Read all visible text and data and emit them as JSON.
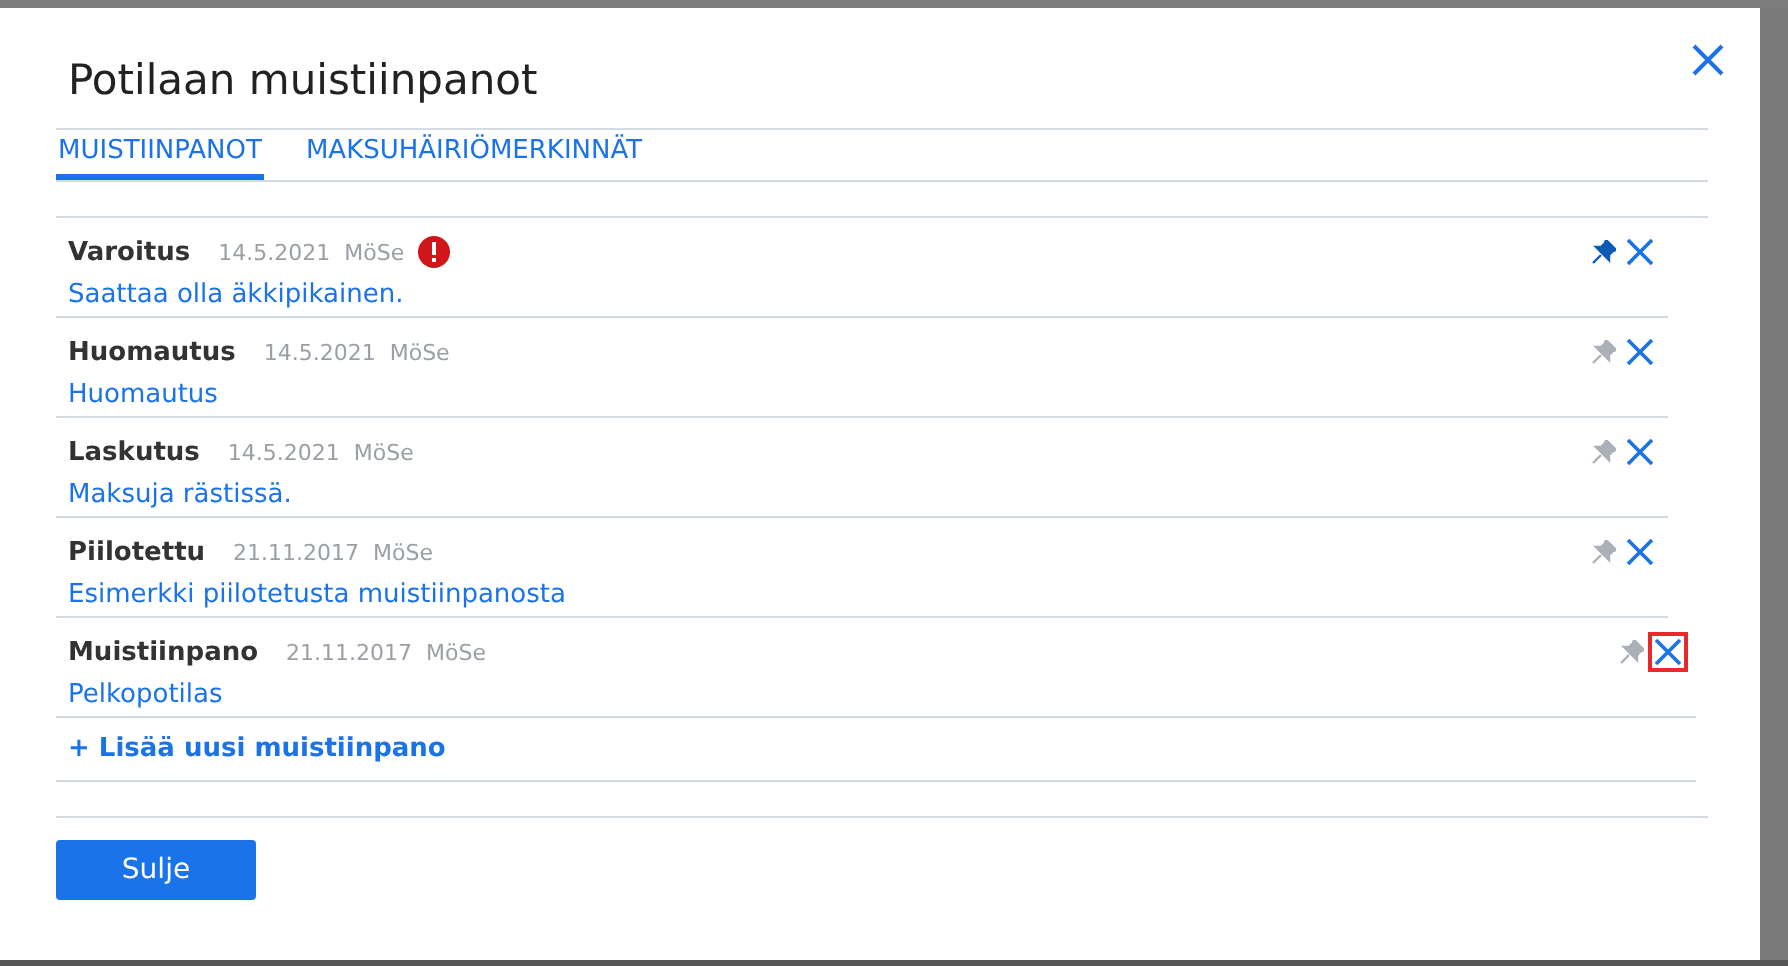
{
  "dialog": {
    "title": "Potilaan muistiinpanot"
  },
  "tabs": [
    {
      "label": "MUISTIINPANOT",
      "selected": true
    },
    {
      "label": "MAKSUHÄIRIÖMERKINNÄT",
      "selected": false
    }
  ],
  "notes": [
    {
      "type": "Varoitus",
      "date": "14.5.2021",
      "author": "MöSe",
      "warning": true,
      "text": "Saattaa olla äkkipikainen.",
      "pinned": true,
      "highlighted": false
    },
    {
      "type": "Huomautus",
      "date": "14.5.2021",
      "author": "MöSe",
      "warning": false,
      "text": "Huomautus",
      "pinned": false,
      "highlighted": false
    },
    {
      "type": "Laskutus",
      "date": "14.5.2021",
      "author": "MöSe",
      "warning": false,
      "text": "Maksuja rästissä.",
      "pinned": false,
      "highlighted": false
    },
    {
      "type": "Piilotettu",
      "date": "21.11.2017",
      "author": "MöSe",
      "warning": false,
      "text": "Esimerkki piilotetusta muistiinpanosta",
      "pinned": false,
      "highlighted": false
    },
    {
      "type": "Muistiinpano",
      "date": "21.11.2017",
      "author": "MöSe",
      "warning": false,
      "text": "Pelkopotilas",
      "pinned": false,
      "highlighted": true
    }
  ],
  "add_link": "+ Lisää uusi muistiinpano",
  "buttons": [
    "Sulje"
  ]
}
